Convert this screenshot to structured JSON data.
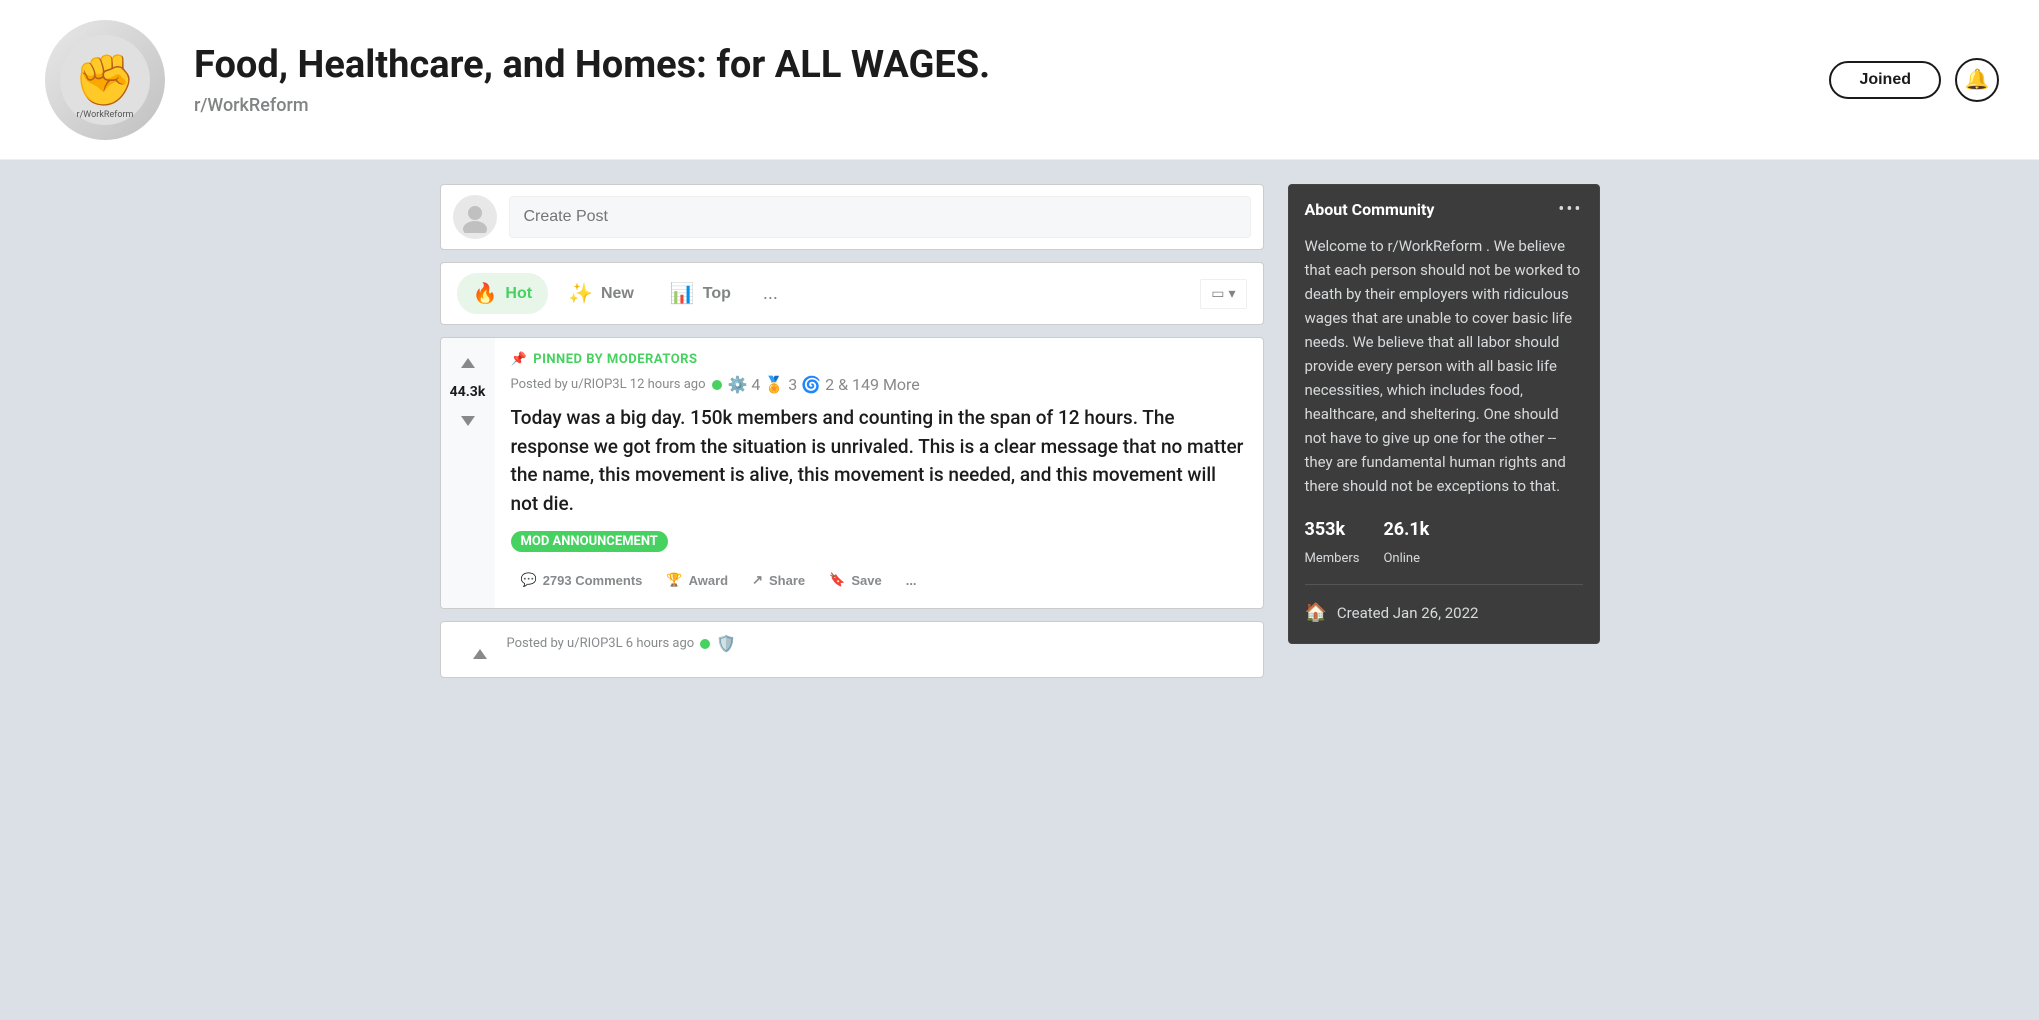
{
  "header": {
    "title": "Food, Healthcare, and Homes: for ALL WAGES.",
    "subreddit": "r/WorkReform",
    "joined_label": "Joined",
    "logo_emoji": "✊"
  },
  "create_post": {
    "placeholder": "Create Post"
  },
  "sort_tabs": {
    "hot_label": "Hot",
    "new_label": "New",
    "top_label": "Top",
    "more_label": "...",
    "view_label": "▭"
  },
  "post1": {
    "pinned_label": "PINNED BY MODERATORS",
    "vote_count": "44.3k",
    "meta": "Posted by u/RIOP3L 12 hours ago",
    "awards": "4  3  2 & 149 More",
    "title": "Today was a big day. 150k members and counting in the span of 12 hours. The response we got from the situation is unrivaled. This is a clear message that no matter the name, this movement is alive, this movement is needed, and this movement will not die.",
    "flair": "MOD ANNOUNCEMENT",
    "comments_label": "2793 Comments",
    "award_label": "Award",
    "share_label": "Share",
    "save_label": "Save",
    "more_label": "..."
  },
  "post2": {
    "meta": "Posted by u/RIOP3L 6 hours ago"
  },
  "about": {
    "title": "About Community",
    "description": "Welcome to r/WorkReform . We believe that each person should not be worked to death by their employers with ridiculous wages that are unable to cover basic life needs. We believe that all labor should provide every person with all basic life necessities, which includes food, healthcare, and sheltering. One should not have to give up one for the other -- they are fundamental human rights and there should not be exceptions to that.",
    "members_value": "353k",
    "members_label": "Members",
    "online_value": "26.1k",
    "online_label": "Online",
    "created_label": "Created Jan 26, 2022",
    "more_label": "•••"
  }
}
